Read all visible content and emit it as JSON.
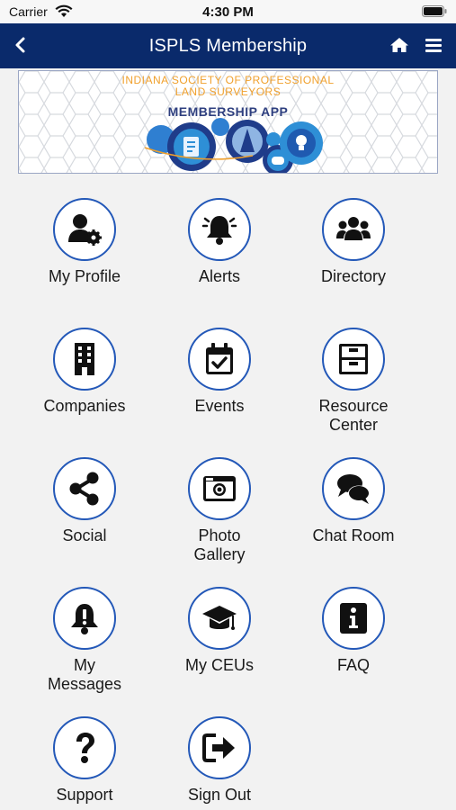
{
  "status_bar": {
    "carrier": "Carrier",
    "time": "4:30 PM"
  },
  "nav": {
    "title": "ISPLS Membership",
    "back_icon": "chevron-left-icon",
    "home_icon": "home-icon",
    "menu_icon": "hamburger-menu-icon"
  },
  "banner": {
    "org_line1": "INDIANA SOCIETY OF PROFESSIONAL",
    "org_line2": "LAND SURVEYORS",
    "app_name": "MEMBERSHIP APP"
  },
  "menu": [
    {
      "label": "My Profile",
      "icon": "user-gear-icon"
    },
    {
      "label": "Alerts",
      "icon": "bell-icon"
    },
    {
      "label": "Directory",
      "icon": "users-group-icon"
    },
    {
      "label": "Companies",
      "icon": "building-icon"
    },
    {
      "label": "Events",
      "icon": "calendar-check-icon"
    },
    {
      "label": "Resource\nCenter",
      "icon": "filing-cabinet-icon"
    },
    {
      "label": "Social",
      "icon": "share-icon"
    },
    {
      "label": "Photo\nGallery",
      "icon": "camera-icon"
    },
    {
      "label": "Chat Room",
      "icon": "chat-bubbles-icon"
    },
    {
      "label": "My\nMessages",
      "icon": "bell-exclamation-icon"
    },
    {
      "label": "My CEUs",
      "icon": "graduation-cap-icon"
    },
    {
      "label": "FAQ",
      "icon": "info-icon"
    },
    {
      "label": "Support",
      "icon": "question-icon"
    },
    {
      "label": "Sign Out",
      "icon": "sign-out-icon"
    }
  ],
  "colors": {
    "nav_bg": "#0a2a6b",
    "circle_border": "#2358b8",
    "page_bg": "#f2f2f2",
    "banner_accent": "#f0a02c"
  }
}
